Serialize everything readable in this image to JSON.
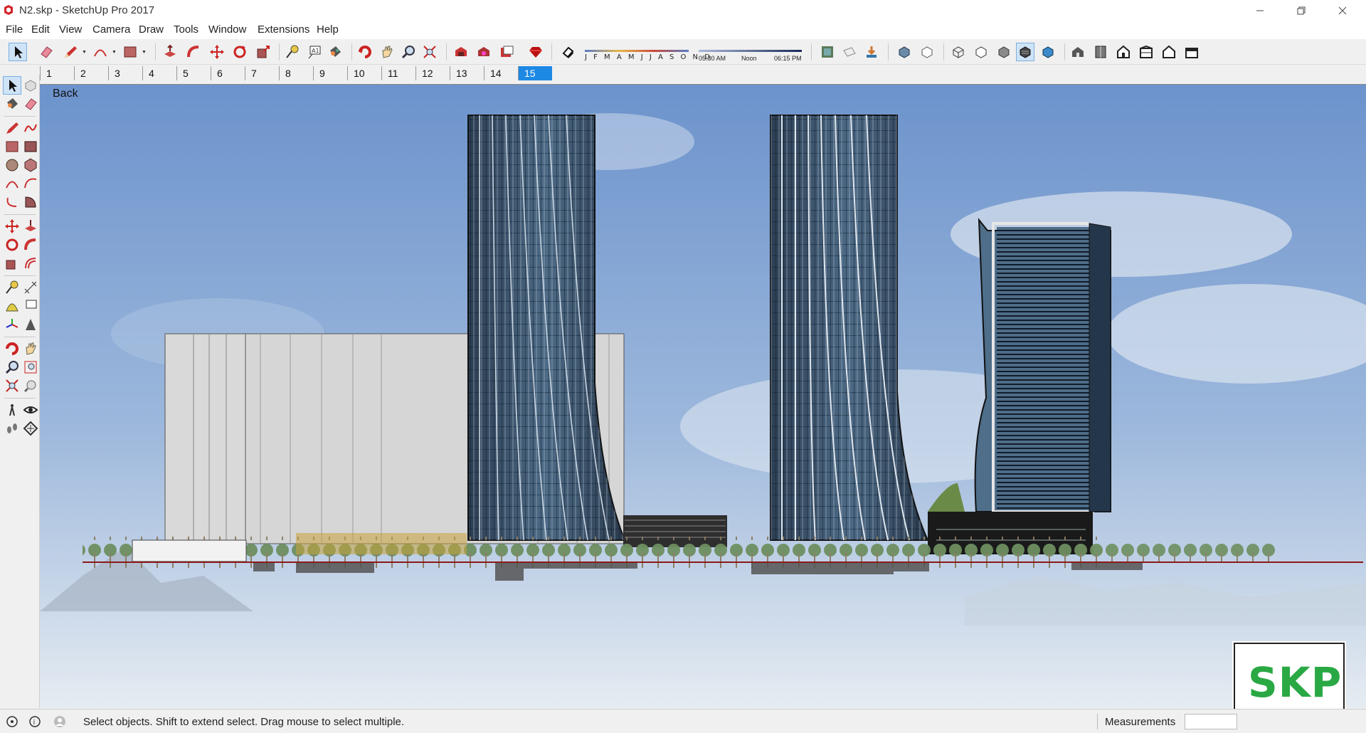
{
  "window": {
    "title": "N2.skp - SketchUp Pro 2017"
  },
  "menu": [
    "File",
    "Edit",
    "View",
    "Camera",
    "Draw",
    "Tools",
    "Window",
    "Extensions",
    "Help"
  ],
  "shadows": {
    "months": "J F M A M J J A S O N D",
    "time_start": "05:30 AM",
    "time_mid": "Noon",
    "time_end": "06:15 PM"
  },
  "scenes": {
    "tabs": [
      "1",
      "2",
      "3",
      "4",
      "5",
      "6",
      "7",
      "8",
      "9",
      "10",
      "11",
      "12",
      "13",
      "14",
      "15"
    ],
    "active": "15"
  },
  "viewport": {
    "scene_label": "Back",
    "sky_color": "#7fa3d3"
  },
  "logo": {
    "text": "SKP",
    "color": "#2aa844"
  },
  "status": {
    "message": "Select objects. Shift to extend select. Drag mouse to select multiple.",
    "measurements_label": "Measurements",
    "measurements_value": ""
  },
  "icons": {
    "toolbar": [
      "select-icon",
      "eraser-icon",
      "pencil-line-icon",
      "arc-icon",
      "rectangle-icon",
      "push-pull-icon",
      "follow-me-icon",
      "move-icon",
      "rotate-icon",
      "scale-icon",
      "tape-measure-icon",
      "text-icon",
      "paint-bucket-icon",
      "orbit-icon",
      "pan-icon",
      "zoom-icon",
      "zoom-extents-icon",
      "warehouse-icon",
      "extension-warehouse-icon",
      "layout-icon",
      "ruby-icon",
      "shadow-toggle-icon",
      "styles-icon",
      "section-plane-icon",
      "xray-icon",
      "wireframe-icon",
      "hidden-line-icon",
      "shaded-icon",
      "textured-icon",
      "monochrome-icon",
      "iso-view-icon",
      "top-view-icon",
      "front-view-icon",
      "right-view-icon",
      "back-view-icon",
      "left-view-icon"
    ]
  }
}
